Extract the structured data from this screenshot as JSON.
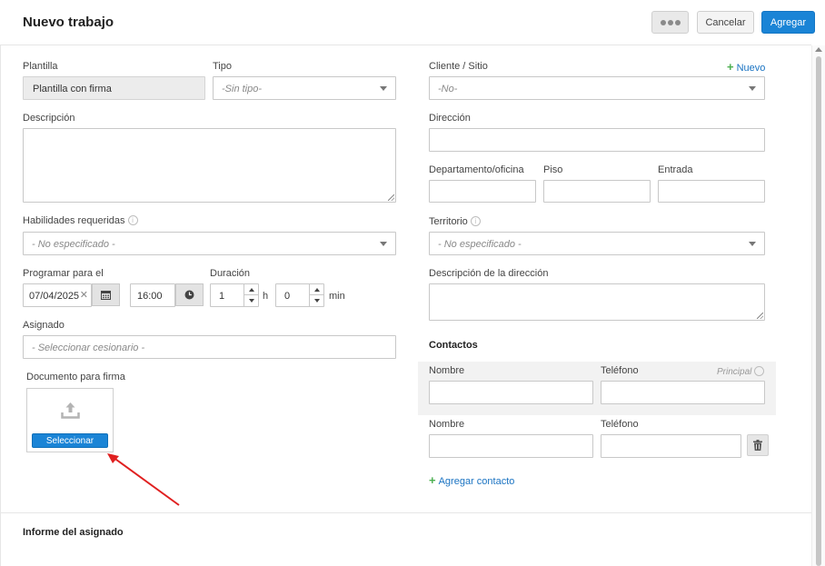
{
  "header": {
    "title": "Nuevo trabajo",
    "cancel_label": "Cancelar",
    "add_label": "Agregar"
  },
  "left": {
    "template_label": "Plantilla",
    "template_value": "Plantilla con firma",
    "type_label": "Tipo",
    "type_value": "-Sin tipo-",
    "description_label": "Descripción",
    "skills_label": "Habilidades requeridas",
    "skills_value": "- No especificado -",
    "schedule_label": "Programar para el",
    "date_value": "07/04/2025",
    "time_value": "16:00",
    "duration_label": "Duración",
    "hours_value": "1",
    "hours_unit": "h",
    "minutes_value": "0",
    "minutes_unit": "min",
    "assigned_label": "Asignado",
    "assigned_placeholder": "- Seleccionar cesionario -",
    "document_label": "Documento para firma",
    "select_button": "Seleccionar"
  },
  "right": {
    "client_label": "Cliente / Sitio",
    "new_link": "Nuevo",
    "client_value": "-No-",
    "address_label": "Dirección",
    "apartment_label": "Departamento/oficina",
    "floor_label": "Piso",
    "entrance_label": "Entrada",
    "territory_label": "Territorio",
    "territory_value": "- No especificado -",
    "address_desc_label": "Descripción de la dirección",
    "contacts_title": "Contactos",
    "contacts": [
      {
        "name_label": "Nombre",
        "phone_label": "Teléfono",
        "principal_label": "Principal"
      },
      {
        "name_label": "Nombre",
        "phone_label": "Teléfono"
      }
    ],
    "add_contact_link": "Agregar contacto"
  },
  "footer": {
    "assignee_report_title": "Informe del asignado"
  },
  "colors": {
    "primary": "#1a84d6",
    "link": "#1a73c2",
    "plus_icon": "#4caf50",
    "arrow": "#e02020"
  }
}
